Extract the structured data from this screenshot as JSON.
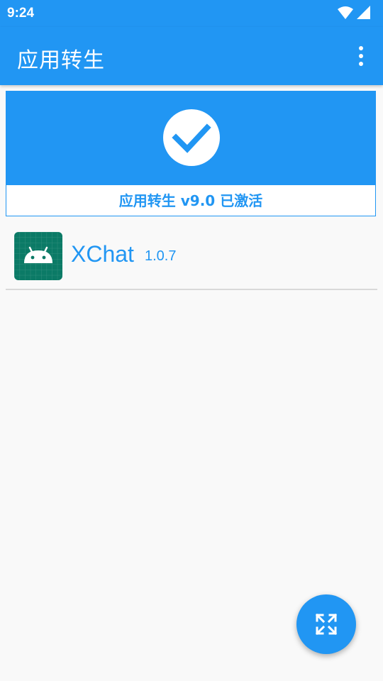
{
  "statusbar": {
    "time": "9:24",
    "icons": [
      "wifi-icon",
      "signal-icon"
    ]
  },
  "appbar": {
    "title": "应用转生",
    "menu_icon": "more-vert-icon"
  },
  "status_card": {
    "icon": "check-icon",
    "text": "应用转生 v9.0 已激活"
  },
  "apps": [
    {
      "name": "XChat",
      "version": "1.0.7",
      "icon": "android-icon"
    }
  ],
  "fab": {
    "icon": "expand-arrows-icon"
  },
  "colors": {
    "primary": "#2196f3",
    "background": "#f9f9f9",
    "android_icon_bg": "#0b7a66",
    "divider": "#d9d9d9"
  }
}
